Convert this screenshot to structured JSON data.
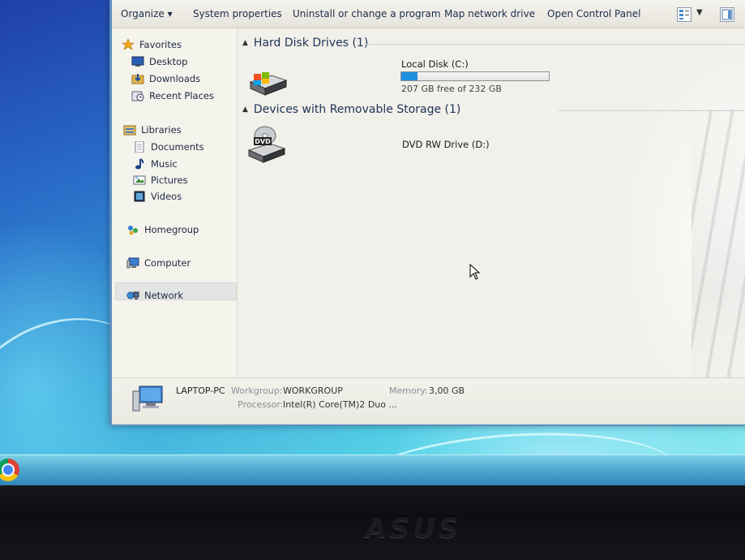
{
  "toolbar": {
    "organize": "Organize ▾",
    "system_properties": "System properties",
    "uninstall": "Uninstall or change a program",
    "map_drive": "Map network drive",
    "control_panel": "Open Control Panel"
  },
  "nav": {
    "favorites": "Favorites",
    "desktop": "Desktop",
    "downloads": "Downloads",
    "recent_places": "Recent Places",
    "libraries": "Libraries",
    "documents": "Documents",
    "music": "Music",
    "pictures": "Pictures",
    "videos": "Videos",
    "homegroup": "Homegroup",
    "computer": "Computer",
    "network": "Network"
  },
  "groups": {
    "hard_disk": "Hard Disk Drives (1)",
    "removable": "Devices with Removable Storage (1)"
  },
  "drives": {
    "local": {
      "name": "Local Disk (C:)",
      "free_text": "207 GB free of 232 GB",
      "used_fraction": 0.11
    },
    "dvd": {
      "name": "DVD RW Drive (D:)",
      "badge": "DVD"
    }
  },
  "details": {
    "pc_name": "LAPTOP-PC",
    "workgroup_label": "Workgroup:",
    "workgroup": "WORKGROUP",
    "memory_label": "Memory:",
    "memory": "3,00 GB",
    "processor_label": "Processor:",
    "processor": "Intel(R) Core(TM)2 Duo ..."
  },
  "bezel": {
    "brand": "ASUS"
  },
  "colors": {
    "bar_fill": "#1f8fe0",
    "nav_text": "#1d2742",
    "heading_text": "#1e3158"
  }
}
